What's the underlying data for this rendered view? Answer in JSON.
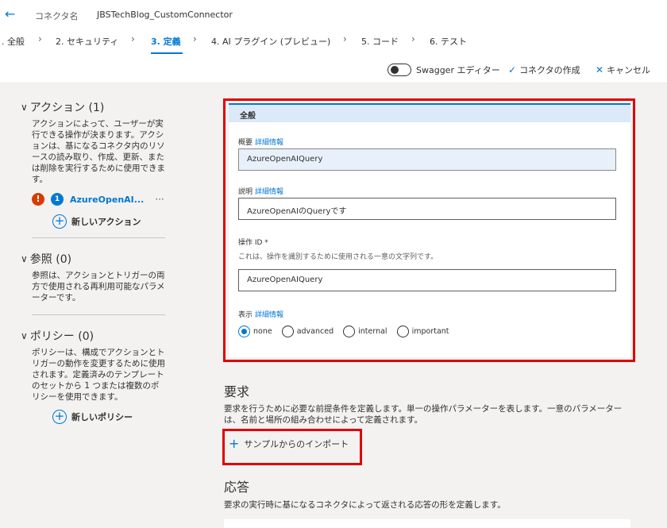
{
  "header": {
    "connector_label": "コネクタ名",
    "connector_name": "JBSTechBlog_CustomConnector"
  },
  "tabs": [
    {
      "label": ". 全般"
    },
    {
      "label": "2. セキュリティ"
    },
    {
      "label": "3. 定義"
    },
    {
      "label": "4. AI プラグイン (プレビュー)"
    },
    {
      "label": "5. コード"
    },
    {
      "label": "6. テスト"
    }
  ],
  "actions": {
    "swagger_label": "Swagger エディター",
    "create_label": "コネクタの作成",
    "cancel_label": "キャンセル"
  },
  "left": {
    "actions_section": {
      "title": "アクション (1)",
      "description": "アクションによって、ユーザーが実行できる操作が決まります。アクションは、基になるコネクタ内のリソースの読み取り、作成、更新、または削除を実行するために使用できます。",
      "operation_number": "1",
      "operation_name": "AzureOpenAI...",
      "new_label": "新しいアクション"
    },
    "references_section": {
      "title": "参照 (0)",
      "description": "参照は、アクションとトリガーの両方で使用される再利用可能なパラメーターです。"
    },
    "policies_section": {
      "title": "ポリシー (0)",
      "description": "ポリシーは、構成でアクションとトリガーの動作を変更するために使用されます。定義済みのテンプレートのセットから 1 つまたは複数のポリシーを使用できます。",
      "new_label": "新しいポリシー"
    }
  },
  "general": {
    "heading": "全般",
    "summary_label": "概要",
    "summary_link": "詳細情報",
    "summary_value": "AzureOpenAIQuery",
    "description_label": "説明",
    "description_link": "詳細情報",
    "description_value": "AzureOpenAIのQueryです",
    "operation_id_label": "操作 ID *",
    "operation_id_hint": "これは、操作を識別するために使用される一意の文字列です。",
    "operation_id_value": "AzureOpenAIQuery",
    "visibility_label": "表示",
    "visibility_link": "詳細情報",
    "visibility_options": [
      "none",
      "advanced",
      "internal",
      "important"
    ],
    "visibility_selected": "none"
  },
  "request": {
    "title": "要求",
    "description": "要求を行うために必要な前提条件を定義します。単一の操作パラメーターを表します。一意のパラメーターは、名前と場所の組み合わせによって定義されます。",
    "import_label": "サンプルからのインポート"
  },
  "response": {
    "title": "応答",
    "description": "要求の実行時に基になるコネクタによって返される応答の形を定義します。"
  },
  "colors": {
    "accent": "#0078d4",
    "highlight": "#e00000",
    "warning": "#d83b01"
  }
}
